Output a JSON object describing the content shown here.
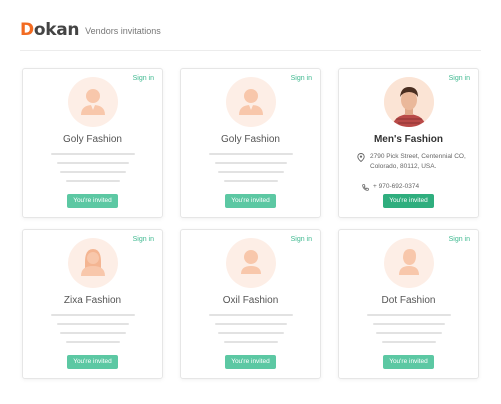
{
  "header": {
    "logo_initial": "D",
    "logo_rest": "okan",
    "title": "Vendors invitations"
  },
  "colors": {
    "brand": "#f26b21",
    "accent": "#3fb990",
    "badge": "#5cc8a3",
    "badge_active": "#2fae7e",
    "avatar_bg": "#fdeee6",
    "avatar_fg": "#f8c7ab"
  },
  "vendors": [
    {
      "name": "Goly Fashion",
      "signin": "Sign in",
      "status": "You're invited",
      "avatar": "male-avatar-icon"
    },
    {
      "name": "Goly Fashion",
      "signin": "Sign in",
      "status": "You're invited",
      "avatar": "male-avatar-icon"
    },
    {
      "name": "Men's Fashion",
      "signin": "Sign in",
      "status": "You're invited",
      "avatar": "photo",
      "address": "2790 Pick Street, Centennial CO, Colorado, 80112, USA.",
      "phone": "+ 970-692-0374"
    },
    {
      "name": "Zixa Fashion",
      "signin": "Sign in",
      "status": "You're invited",
      "avatar": "female-avatar-icon"
    },
    {
      "name": "Oxil Fashion",
      "signin": "Sign in",
      "status": "You're invited",
      "avatar": "user-avatar-icon"
    },
    {
      "name": "Dot Fashion",
      "signin": "Sign in",
      "status": "You're invited",
      "avatar": "user-avatar-icon"
    }
  ]
}
